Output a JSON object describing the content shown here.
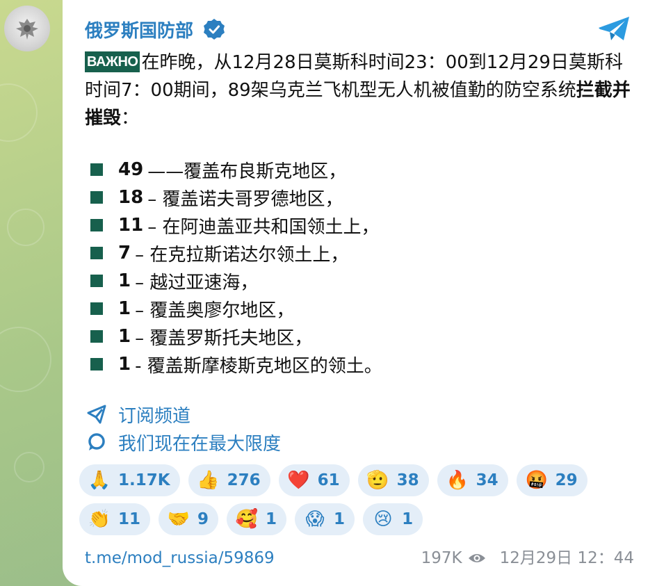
{
  "channel": {
    "name": "俄罗斯国防部",
    "verified": true,
    "avatar": "ministry-emblem-avatar"
  },
  "post": {
    "tag": "ВАЖНО",
    "intro_1": "在昨晚，从12月28日莫斯科时间23：00到12月29日莫斯科时间7：00期间，89架乌克兰飞机型无人机被值勤的防空系统",
    "intro_bold": "拦截并摧毁",
    "intro_end": "：",
    "items": [
      {
        "num": "49",
        "text": "——覆盖布良斯克地区，"
      },
      {
        "num": "18",
        "text": " – 覆盖诺夫哥罗德地区，"
      },
      {
        "num": "11",
        "text": " – 在阿迪盖亚共和国领土上，"
      },
      {
        "num": "7",
        "text": " – 在克拉斯诺达尔领土上，"
      },
      {
        "num": "1",
        "text": " – 越过亚速海，"
      },
      {
        "num": "1",
        "text": " – 覆盖奥廖尔地区，"
      },
      {
        "num": "1",
        "text": " – 覆盖罗斯托夫地区，"
      },
      {
        "num": "1",
        "text": " - 覆盖斯摩棱斯克地区的领土。"
      }
    ],
    "subscribe_label": "订阅频道",
    "max_label": "我们现在在最大限度"
  },
  "reactions": [
    [
      {
        "emoji": "🙏",
        "icon": "pray-emoji",
        "count": "1.17K"
      },
      {
        "emoji": "👍",
        "icon": "thumbs-up-emoji",
        "count": "276"
      },
      {
        "emoji": "❤️",
        "icon": "heart-emoji",
        "count": "61"
      },
      {
        "emoji": "🫡",
        "icon": "salute-emoji",
        "count": "38"
      },
      {
        "emoji": "🔥",
        "icon": "fire-emoji",
        "count": "34"
      },
      {
        "emoji": "🤬",
        "icon": "cursing-face-emoji",
        "count": "29"
      }
    ],
    [
      {
        "emoji": "👏",
        "icon": "clapping-emoji",
        "count": "11"
      },
      {
        "emoji": "🤝",
        "icon": "handshake-emoji",
        "count": "9"
      },
      {
        "emoji": "🥰",
        "icon": "smiling-hearts-emoji",
        "count": "1"
      },
      {
        "emoji": "😱",
        "icon": "screaming-face-emoji",
        "count": "1"
      },
      {
        "emoji": "😢",
        "icon": "crying-face-emoji",
        "count": "1"
      }
    ]
  ],
  "footer": {
    "permalink": "t.me/mod_russia/59869",
    "views": "197K",
    "timestamp": "12月29日 12：44"
  },
  "colors": {
    "accent": "#2c7fc0",
    "tag_bg": "#17604d",
    "chip_bg": "#e4eef8",
    "meta": "#8a8f96"
  }
}
